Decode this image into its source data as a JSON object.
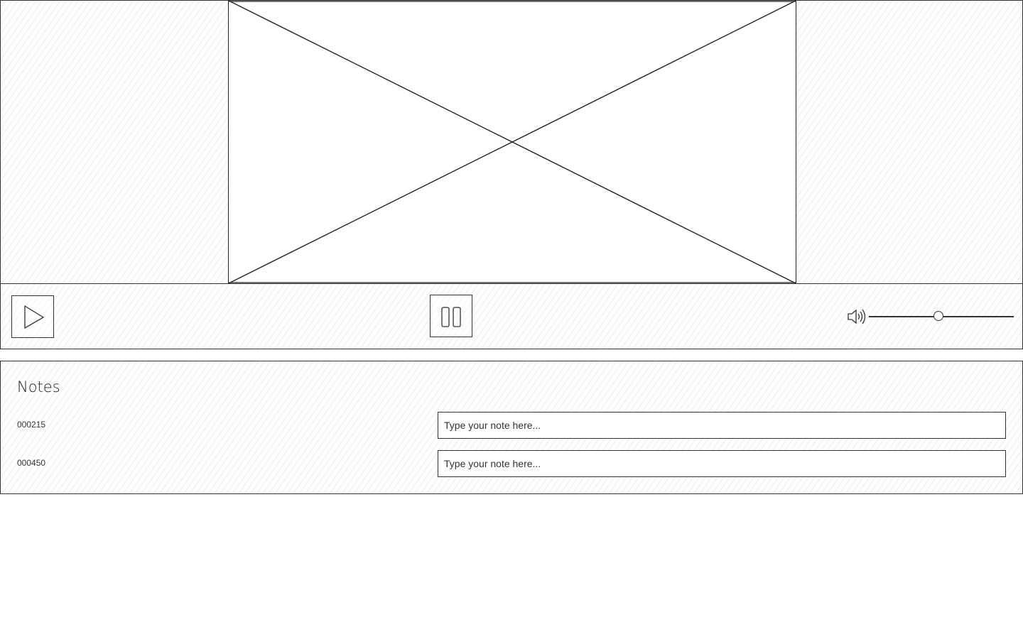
{
  "player": {
    "video_placeholder_icon": "image-placeholder-icon",
    "controls": {
      "play_icon": "play-icon",
      "pause_icon": "pause-icon",
      "volume_icon": "speaker-icon",
      "volume_level": 0.48
    }
  },
  "notes": {
    "title": "Notes",
    "entries": [
      {
        "timestamp": "000215",
        "value": "",
        "placeholder": "Type your note here..."
      },
      {
        "timestamp": "000450",
        "value": "",
        "placeholder": "Type your note here..."
      }
    ]
  }
}
